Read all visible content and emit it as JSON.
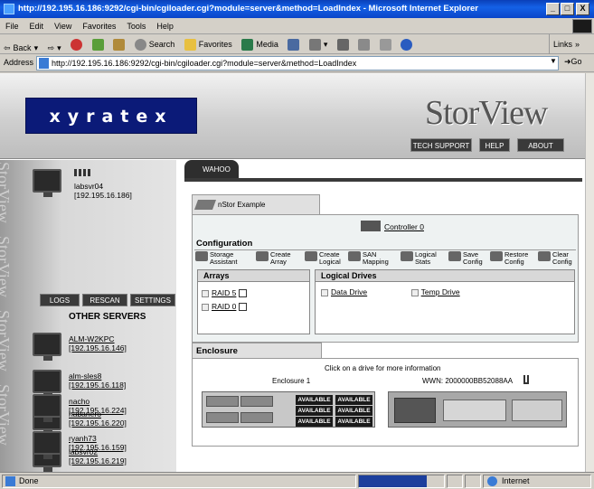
{
  "window": {
    "title": "http://192.195.16.186:9292/cgi-bin/cgiloader.cgi?module=server&method=LoadIndex - Microsoft Internet Explorer",
    "min": "_",
    "max": "□",
    "close": "X"
  },
  "menu": [
    "File",
    "Edit",
    "View",
    "Favorites",
    "Tools",
    "Help"
  ],
  "toolbar": {
    "back": "Back",
    "search": "Search",
    "favorites": "Favorites",
    "media": "Media",
    "links": "Links"
  },
  "address": {
    "label": "Address",
    "url": "http://192.195.16.186:9292/cgi-bin/cgiloader.cgi?module=server&method=LoadIndex",
    "go": "Go"
  },
  "header": {
    "logo": "xyratex",
    "brand": "StorView",
    "buttons": [
      "TECH SUPPORT",
      "HELP",
      "ABOUT"
    ]
  },
  "sidebar": {
    "watermark": "StorView",
    "current": {
      "name": "labsvr04",
      "ip": "[192.195.16.186]"
    },
    "buttons": [
      "LOGS",
      "RESCAN",
      "SETTINGS"
    ],
    "other_title": "OTHER SERVERS",
    "servers": [
      {
        "name": "ALM-W2KPC",
        "ip": "[192.195.16.146]"
      },
      {
        "name": "alm-sles8",
        "ip": "[192.195.16.118]"
      },
      {
        "name": "habanero",
        "ip": "[192.195.16.220]"
      },
      {
        "name": "labsvr02",
        "ip": "[192.195.16.219]"
      },
      {
        "name": "nacho",
        "ip": "[192.195.16.224]"
      },
      {
        "name": "ryanh73",
        "ip": "[192.195.16.159]"
      }
    ]
  },
  "main": {
    "tab": "WAHOO",
    "subtab": "nStor Example",
    "controller": "Controller 0",
    "config_title": "Configuration",
    "actions": [
      {
        "l1": "Storage",
        "l2": "Assistant"
      },
      {
        "l1": "Create",
        "l2": "Array"
      },
      {
        "l1": "Create",
        "l2": "Logical"
      },
      {
        "l1": "SAN",
        "l2": "Mapping"
      },
      {
        "l1": "Logical",
        "l2": "Stats"
      },
      {
        "l1": "Save",
        "l2": "Config"
      },
      {
        "l1": "Restore",
        "l2": "Config"
      },
      {
        "l1": "Clear",
        "l2": "Config"
      }
    ],
    "arrays_title": "Arrays",
    "arrays": [
      "RAID 5",
      "RAID 0"
    ],
    "logical_title": "Logical Drives",
    "logical": [
      "Data Drive",
      "Temp Drive"
    ],
    "enclosure_title": "Enclosure",
    "enclosure_hint": "Click on a drive for more information",
    "enclosure_name": "Enclosure 1",
    "wwn": "WWN: 2000000BB52088AA",
    "drive_label": "AVAILABLE"
  },
  "status": {
    "text": "Done",
    "zone": "Internet"
  }
}
